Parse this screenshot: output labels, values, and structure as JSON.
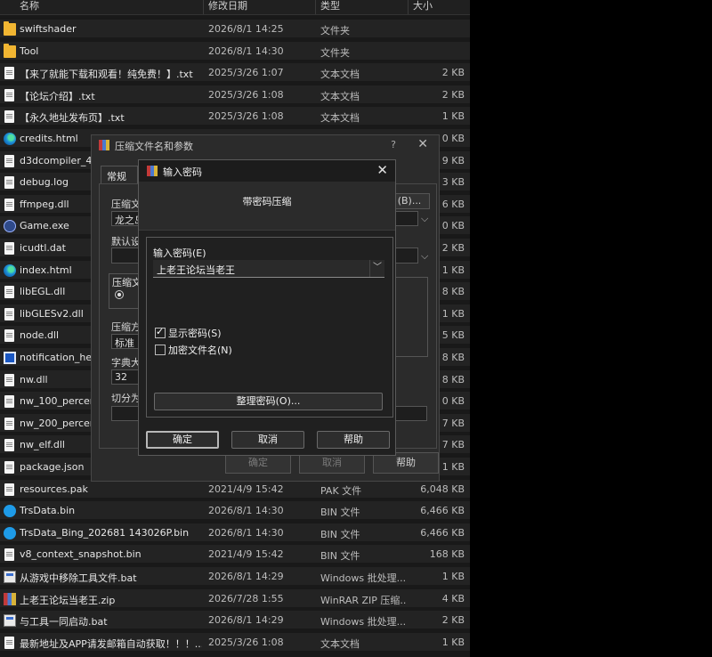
{
  "explorer": {
    "columns": {
      "name": "名称",
      "date": "修改日期",
      "type": "类型",
      "size": "大小"
    },
    "rows": [
      {
        "name": "swiftshader",
        "date": "2026/8/1 14:25",
        "type": "文件夹",
        "size": "",
        "icon": "folder-icon"
      },
      {
        "name": "Tool",
        "date": "2026/8/1 14:30",
        "type": "文件夹",
        "size": "",
        "icon": "folder-icon"
      },
      {
        "name": "【来了就能下载和观看！纯免费！】.txt",
        "date": "2025/3/26 1:07",
        "type": "文本文档",
        "size": "2 KB",
        "icon": "text-file-icon"
      },
      {
        "name": "【论坛介绍】.txt",
        "date": "2025/3/26 1:08",
        "type": "文本文档",
        "size": "2 KB",
        "icon": "text-file-icon"
      },
      {
        "name": "【永久地址发布页】.txt",
        "date": "2025/3/26 1:08",
        "type": "文本文档",
        "size": "1 KB",
        "icon": "text-file-icon"
      },
      {
        "name": "credits.html",
        "date": "",
        "type": "",
        "size": "0 KB",
        "icon": "edge-icon"
      },
      {
        "name": "d3dcompiler_47",
        "date": "",
        "type": "",
        "size": "9 KB",
        "icon": "file-icon"
      },
      {
        "name": "debug.log",
        "date": "",
        "type": "",
        "size": "3 KB",
        "icon": "file-icon"
      },
      {
        "name": "ffmpeg.dll",
        "date": "",
        "type": "",
        "size": "6 KB",
        "icon": "file-icon"
      },
      {
        "name": "Game.exe",
        "date": "",
        "type": "",
        "size": "0 KB",
        "icon": "game-icon"
      },
      {
        "name": "icudtl.dat",
        "date": "",
        "type": "",
        "size": "2 KB",
        "icon": "file-icon"
      },
      {
        "name": "index.html",
        "date": "",
        "type": "",
        "size": "1 KB",
        "icon": "edge-icon"
      },
      {
        "name": "libEGL.dll",
        "date": "",
        "type": "",
        "size": "8 KB",
        "icon": "file-icon"
      },
      {
        "name": "libGLESv2.dll",
        "date": "",
        "type": "",
        "size": "1 KB",
        "icon": "file-icon"
      },
      {
        "name": "node.dll",
        "date": "",
        "type": "",
        "size": "5 KB",
        "icon": "file-icon"
      },
      {
        "name": "notification_help",
        "date": "",
        "type": "",
        "size": "8 KB",
        "icon": "app-icon"
      },
      {
        "name": "nw.dll",
        "date": "",
        "type": "",
        "size": "8 KB",
        "icon": "file-icon"
      },
      {
        "name": "nw_100_percent",
        "date": "",
        "type": "",
        "size": "0 KB",
        "icon": "file-icon"
      },
      {
        "name": "nw_200_percent",
        "date": "",
        "type": "",
        "size": "7 KB",
        "icon": "file-icon"
      },
      {
        "name": "nw_elf.dll",
        "date": "",
        "type": "",
        "size": "7 KB",
        "icon": "file-icon"
      },
      {
        "name": "package.json",
        "date": "",
        "type": "",
        "size": "1 KB",
        "icon": "file-icon"
      },
      {
        "name": "resources.pak",
        "date": "2021/4/9 15:42",
        "type": "PAK 文件",
        "size": "6,048 KB",
        "icon": "file-icon"
      },
      {
        "name": "TrsData.bin",
        "date": "2026/8/1 14:30",
        "type": "BIN 文件",
        "size": "6,466 KB",
        "icon": "trs-icon"
      },
      {
        "name": "TrsData_Bing_202681 143026P.bin",
        "date": "2026/8/1 14:30",
        "type": "BIN 文件",
        "size": "6,466 KB",
        "icon": "trs-icon"
      },
      {
        "name": "v8_context_snapshot.bin",
        "date": "2021/4/9 15:42",
        "type": "BIN 文件",
        "size": "168 KB",
        "icon": "file-icon"
      },
      {
        "name": "从游戏中移除工具文件.bat",
        "date": "2026/8/1 14:29",
        "type": "Windows 批处理...",
        "size": "1 KB",
        "icon": "batch-icon"
      },
      {
        "name": "上老王论坛当老王.zip",
        "date": "2026/7/28 1:55",
        "type": "WinRAR ZIP 压缩...",
        "size": "4 KB",
        "icon": "winrar-icon"
      },
      {
        "name": "与工具一同启动.bat",
        "date": "2026/8/1 14:29",
        "type": "Windows 批处理...",
        "size": "2 KB",
        "icon": "batch-icon"
      },
      {
        "name": "最新地址及APP请发邮箱自动获取！！！....",
        "date": "2025/3/26 1:08",
        "type": "文本文档",
        "size": "1 KB",
        "icon": "text-file-icon"
      }
    ]
  },
  "archive_dialog": {
    "title": "压缩文件名和参数",
    "help_glyph": "?",
    "close_glyph": "✕",
    "tab_general": "常规",
    "label_archive_name": "压缩文",
    "archive_name_value": "龙之岛",
    "label_default": "默认设",
    "browse_label": "(B)...",
    "label_format": "压缩文",
    "label_method": "压缩方",
    "method_value": "标准",
    "label_dict": "字典大",
    "dict_value": "32",
    "label_split": "切分为",
    "ok_label": "确定",
    "cancel_label": "取消",
    "help_label": "帮助"
  },
  "password_dialog": {
    "title": "输入密码",
    "close_glyph": "✕",
    "header_text": "带密码压缩",
    "password_label": "输入密码(E)",
    "password_value": "上老王论坛当老王",
    "show_password_label": "显示密码(S)",
    "show_password_checked": true,
    "encrypt_names_label": "加密文件名(N)",
    "encrypt_names_checked": false,
    "organize_button": "整理密码(O)...",
    "ok_label": "确定",
    "cancel_label": "取消",
    "help_label": "帮助"
  }
}
